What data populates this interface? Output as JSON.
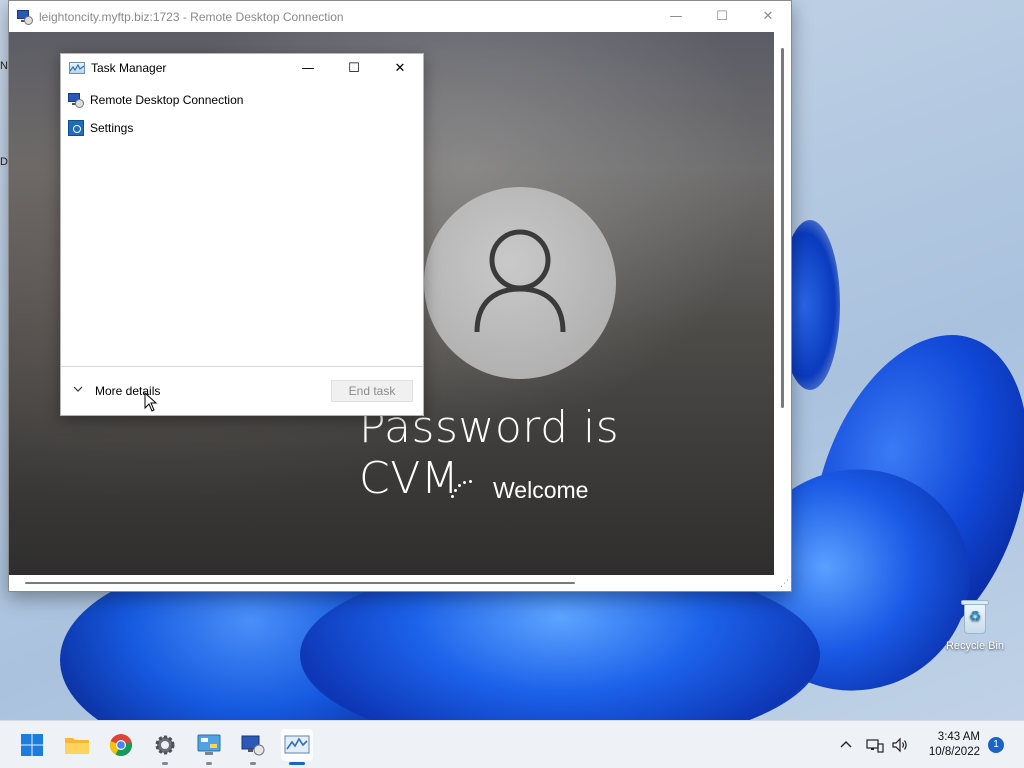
{
  "rdp_window": {
    "title": "leightoncity.myftp.biz:1723 - Remote Desktop Connection",
    "minimize": "—",
    "maximize": "☐",
    "close": "✕"
  },
  "lock_screen": {
    "heading": "Password is CVM",
    "status": "Welcome"
  },
  "task_manager": {
    "title": "Task Manager",
    "minimize": "—",
    "maximize": "☐",
    "close": "✕",
    "items": [
      {
        "label": "Remote Desktop Connection",
        "icon": "rdp-icon"
      },
      {
        "label": "Settings",
        "icon": "settings-gear-icon"
      }
    ],
    "more_details": "More details",
    "end_task": "End task"
  },
  "desktop": {
    "recycle_bin": "Recycle Bin",
    "left_fragments": [
      "N",
      "D"
    ]
  },
  "taskbar": {
    "apps": [
      {
        "name": "start",
        "icon": "windows-start-icon"
      },
      {
        "name": "file-explorer",
        "icon": "folder-icon"
      },
      {
        "name": "chrome",
        "icon": "chrome-icon"
      },
      {
        "name": "settings",
        "icon": "gear-icon"
      },
      {
        "name": "control-panel",
        "icon": "control-panel-icon"
      },
      {
        "name": "remote-desktop",
        "icon": "rdp-icon"
      },
      {
        "name": "task-manager",
        "icon": "task-manager-icon",
        "active": true
      }
    ],
    "time": "3:43 AM",
    "date": "10/8/2022",
    "notification_count": "1"
  },
  "colors": {
    "accent": "#1a63c9",
    "taskbar_bg": "#eef1f6"
  }
}
